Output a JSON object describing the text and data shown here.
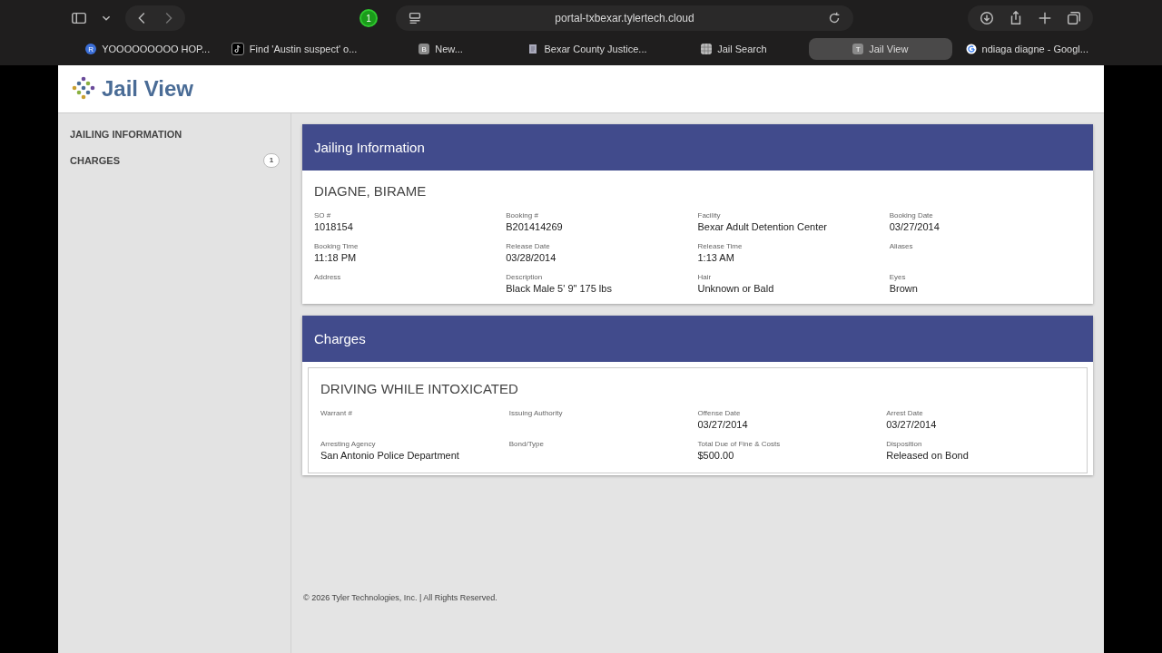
{
  "browser": {
    "extensions_badge": "1",
    "address": "portal-txbexar.tylertech.cloud",
    "tabs": [
      {
        "label": "YOOOOOOOOO HOP...",
        "selected": false,
        "kind": "letter",
        "letter": "R"
      },
      {
        "label": "Find 'Austin suspect' o...",
        "selected": false,
        "kind": "tiktok"
      },
      {
        "label": "New...",
        "selected": false,
        "kind": "letter",
        "letter": "B"
      },
      {
        "label": "Bexar County Justice...",
        "selected": false,
        "kind": "doc"
      },
      {
        "label": "Jail Search",
        "selected": false,
        "kind": "grid"
      },
      {
        "label": "Jail View",
        "selected": true,
        "kind": "letter",
        "letter": "T"
      },
      {
        "label": "ndiaga diagne - Googl...",
        "selected": false,
        "kind": "google"
      }
    ]
  },
  "site": {
    "logo_text": "Jail View"
  },
  "sidebar": {
    "items": [
      {
        "label": "JAILING INFORMATION",
        "selected": false
      },
      {
        "label": "CHARGES",
        "selected": false,
        "badge": "1"
      }
    ]
  },
  "jailing": {
    "title": "Jailing Information",
    "name": "DIAGNE, BIRAME",
    "fields": [
      {
        "label": "SO #",
        "value": "1018154"
      },
      {
        "label": "Booking #",
        "value": "B201414269"
      },
      {
        "label": "Facility",
        "value": "Bexar Adult Detention Center"
      },
      {
        "label": "Booking Date",
        "value": "03/27/2014"
      },
      {
        "label": "Booking Time",
        "value": "11:18 PM"
      },
      {
        "label": "Release Date",
        "value": "03/28/2014"
      },
      {
        "label": "Release Time",
        "value": "1:13 AM"
      },
      {
        "label": "Aliases"
      },
      {
        "label": "Address"
      },
      {
        "label": "Description",
        "value": "Black Male 5' 9\" 175 lbs"
      },
      {
        "label": "Hair",
        "value": "Unknown or Bald"
      },
      {
        "label": "Eyes",
        "value": "Brown"
      }
    ]
  },
  "charges": {
    "title": "Charges",
    "items": [
      {
        "title": "DRIVING WHILE INTOXICATED",
        "fields": [
          {
            "label": "Warrant #"
          },
          {
            "label": "Issuing Authority"
          },
          {
            "label": "Offense Date",
            "value": "03/27/2014"
          },
          {
            "label": "Arrest Date",
            "value": "03/27/2014"
          },
          {
            "label": "Arresting Agency",
            "value": "San Antonio Police Department"
          },
          {
            "label": "Bond/Type"
          },
          {
            "label": "Total Due of Fine & Costs",
            "value": "$500.00"
          },
          {
            "label": "Disposition",
            "value": "Released on Bond"
          }
        ]
      }
    ]
  },
  "footer": "© 2026 Tyler Technologies, Inc. | All Rights Reserved."
}
